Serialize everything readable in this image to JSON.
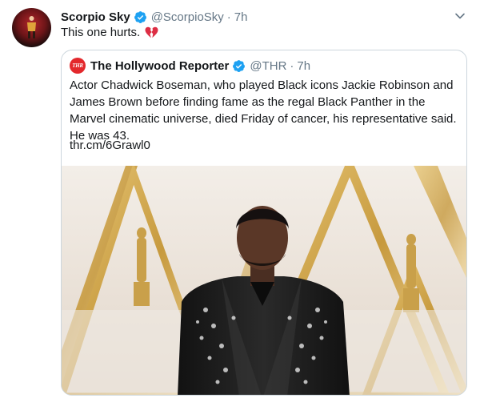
{
  "tweet": {
    "author_name": "Scorpio Sky",
    "author_handle": "@ScorpioSky",
    "separator": "·",
    "time": "7h",
    "text": "This one hurts.",
    "icons": {
      "verified": "verified-badge-icon",
      "more": "chevron-down-icon",
      "emoji": "broken-heart-emoji"
    }
  },
  "quoted": {
    "author_name": "The Hollywood Reporter",
    "logo_text": "THR",
    "author_handle": "@THR",
    "separator": "·",
    "time": "7h",
    "text": "Actor Chadwick Boseman, who played Black icons Jackie Robinson and James Brown before finding fame as the regal Black Panther in the Marvel cinematic universe, died Friday of cancer, his representative said. He was 43.",
    "link": "thr.cm/6Grawl0"
  },
  "colors": {
    "verified": "#1da1f2",
    "secondary_text": "#657786",
    "border": "#ccd6dd",
    "thr_red": "#e3282c",
    "heart_red": "#dd2e44"
  }
}
